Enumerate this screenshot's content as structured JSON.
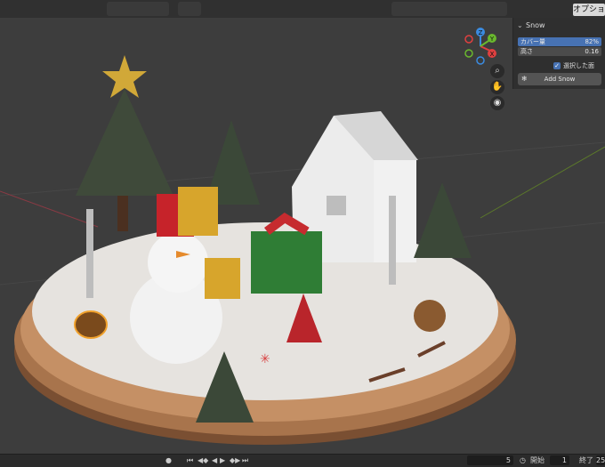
{
  "header": {
    "options_label": "オプショ"
  },
  "snow_panel": {
    "title": "Snow",
    "coverage_label": "カバー量",
    "coverage_value": "82%",
    "coverage_fraction": 0.82,
    "depth_label": "高さ",
    "depth_value": "0.16",
    "selected_faces_label": "選択した面",
    "selected_faces_checked": true,
    "add_button": "Add Snow"
  },
  "gizmo": {
    "x": "X",
    "y": "Y",
    "z": "Z"
  },
  "timeline": {
    "current_frame": "5",
    "start_label": "開始",
    "start_value": "1",
    "end_label": "終了",
    "end_value": "25"
  },
  "colors": {
    "accent": "#4772b3",
    "viewport_bg": "#3d3d3d",
    "panel_bg": "#2f2f2f"
  },
  "icons": [
    "snowflake-icon",
    "zoom-icon",
    "hand-icon",
    "camera-icon",
    "chevron-down-icon",
    "play-icon"
  ]
}
